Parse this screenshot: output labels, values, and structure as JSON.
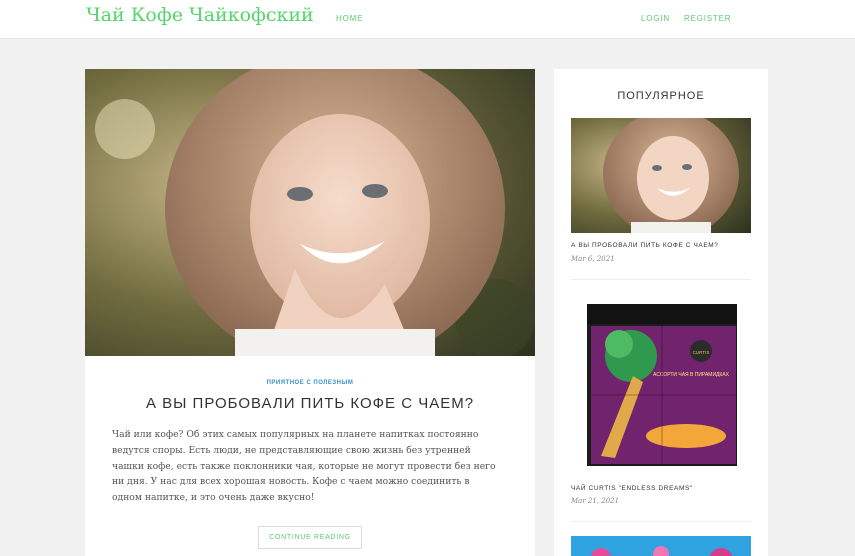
{
  "header": {
    "site_title": "Чай Кофе Чайкофский",
    "nav_home": "HOME",
    "nav_login": "LOGIN",
    "nav_register": "REGISTER",
    "accent_color": "#56d46b"
  },
  "post": {
    "category": "ПРИЯТНОЕ С ПОЛЕЗНЫМ",
    "title": "А ВЫ ПРОБОВАЛИ ПИТЬ КОФЕ С ЧАЕМ?",
    "excerpt": "Чай или кофе? Об этих самых популярных на планете напитках постоянно ведутся споры. Есть люди, не представляющие свою жизнь без утренней чашки кофе, есть также поклонники чая, которые не могут провести без него ни дня. У нас для всех хорошая новость. Кофе с чаем можно соединить в одном напитке, и это очень даже вкусно!",
    "continue_label": "CONTINUE READING"
  },
  "sidebar": {
    "widget_title": "ПОПУЛЯРНОЕ",
    "items": [
      {
        "title": "А ВЫ ПРОБОВАЛИ ПИТЬ КОФЕ С ЧАЕМ?",
        "date": "Mar 6, 2021"
      },
      {
        "title": "ЧАЙ CURTIS \"ENDLESS DREAMS\"",
        "date": "Mar 21, 2021",
        "product_brand": "CURTIS",
        "product_text": "АССОРТИ ЧАЯ В ПИРАМИДКАХ"
      }
    ]
  }
}
